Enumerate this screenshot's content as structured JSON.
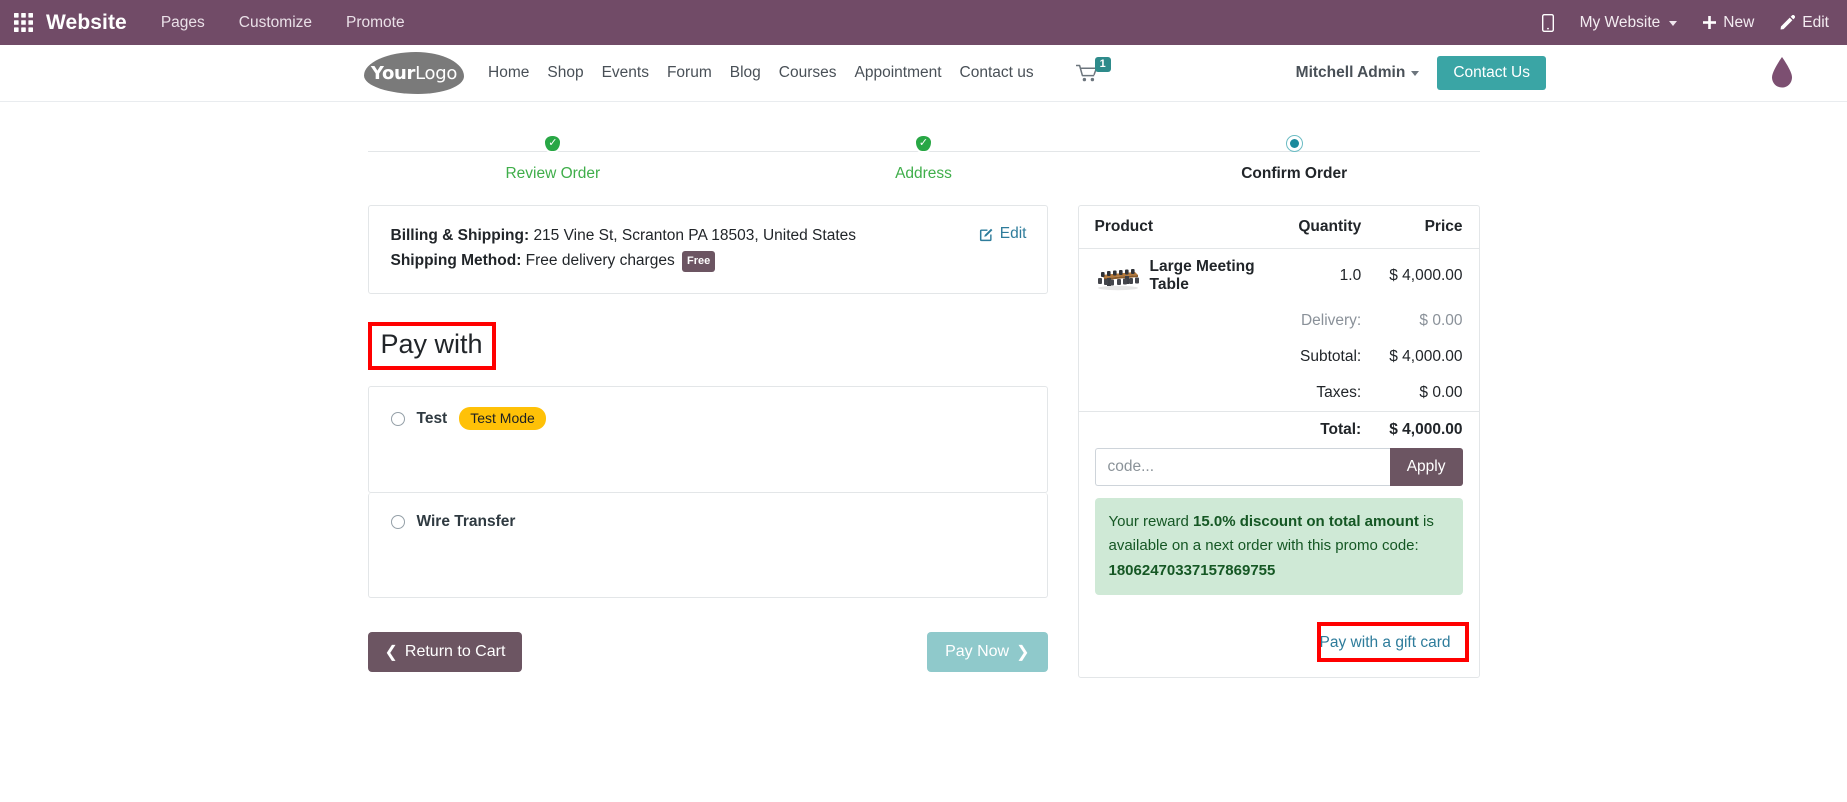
{
  "admin_bar": {
    "apps_icon": "apps-grid-icon",
    "brand": "Website",
    "menu": [
      "Pages",
      "Customize",
      "Promote"
    ],
    "mobile_icon": "mobile-preview-icon",
    "website_selector": "My Website",
    "new_label": "New",
    "new_icon": "plus-icon",
    "edit_label": "Edit",
    "edit_icon": "pencil-icon",
    "bg_color": "#714B67"
  },
  "site_header": {
    "logo_your": "Your",
    "logo_logo": "Logo",
    "nav": [
      "Home",
      "Shop",
      "Events",
      "Forum",
      "Blog",
      "Courses",
      "Appointment",
      "Contact us"
    ],
    "cart_icon": "shopping-cart-icon",
    "cart_count": "1",
    "cart_badge_color": "#2E8B8B",
    "user": "Mitchell Admin",
    "contact_button": "Contact Us",
    "contact_button_color": "#3AA5A5",
    "drop_icon": "water-drop-icon"
  },
  "stepper": {
    "steps": [
      {
        "label": "Review Order",
        "state": "done",
        "icon": "check-circle-icon"
      },
      {
        "label": "Address",
        "state": "done",
        "icon": "check-circle-icon"
      },
      {
        "label": "Confirm Order",
        "state": "current",
        "icon": "current-step-dot-icon"
      }
    ],
    "done_color": "#28A745",
    "current_color": "#1c8a9c"
  },
  "address_card": {
    "billing_label": "Billing & Shipping:",
    "billing_value": "215 Vine St, Scranton PA 18503, United States",
    "shipping_label": "Shipping Method:",
    "shipping_value": "Free delivery charges",
    "shipping_badge": "Free",
    "edit_label": "Edit",
    "edit_icon": "edit-square-icon"
  },
  "pay_with": {
    "heading": "Pay with",
    "options": [
      {
        "name": "Test",
        "badge": "Test Mode",
        "badge_color": "#FFC107",
        "selected": false
      },
      {
        "name": "Wire Transfer",
        "badge": "",
        "selected": false
      }
    ]
  },
  "actions": {
    "return_label": "Return to Cart",
    "return_icon": "chevron-left-icon",
    "return_color": "#6c5562",
    "pay_label": "Pay Now",
    "pay_icon": "chevron-right-icon",
    "pay_color": "#8FC9CB"
  },
  "summary": {
    "columns": [
      "Product",
      "Quantity",
      "Price"
    ],
    "product": {
      "thumb": "large-meeting-table-photo",
      "name": "Large Meeting Table",
      "quantity": "1.0",
      "price": "$ 4,000.00"
    },
    "rows": [
      {
        "label": "Delivery:",
        "value": "$ 0.00",
        "muted": true
      },
      {
        "label": "Subtotal:",
        "value": "$ 4,000.00",
        "muted": false
      },
      {
        "label": "Taxes:",
        "value": "$ 0.00",
        "muted": false
      }
    ],
    "total_label": "Total:",
    "total_value": "$ 4,000.00",
    "promo_placeholder": "code...",
    "promo_value": "",
    "apply_label": "Apply",
    "reward_prefix": "Your reward ",
    "reward_highlight": "15.0% discount on total amount",
    "reward_middle": " is available on a next order with this promo code: ",
    "reward_code": "18062470337157869755",
    "reward_bg": "#cfe9d6",
    "giftcard_label": "Pay with a gift card"
  },
  "annotations": {
    "color": "#FF0000",
    "boxes": [
      "pay-with-heading",
      "pay-with-a-gift-card-link"
    ]
  }
}
